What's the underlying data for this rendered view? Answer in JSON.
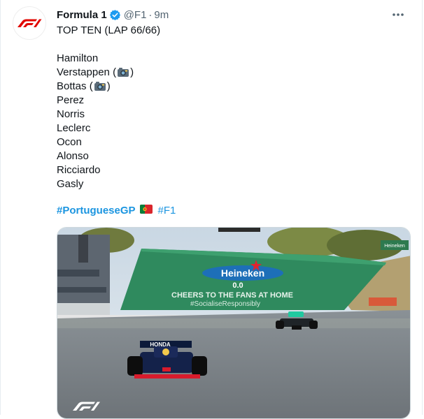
{
  "account": {
    "name": "Formula 1",
    "handle": "@F1",
    "separator": "·",
    "time": "9m"
  },
  "tweet": {
    "headline": "TOP TEN (LAP 66/66)",
    "drivers": [
      {
        "name": "Hamilton",
        "note": ""
      },
      {
        "name": "Verstappen",
        "note": "camera"
      },
      {
        "name": "Bottas",
        "note": "camera"
      },
      {
        "name": "Perez",
        "note": ""
      },
      {
        "name": "Norris",
        "note": ""
      },
      {
        "name": "Leclerc",
        "note": ""
      },
      {
        "name": "Ocon",
        "note": ""
      },
      {
        "name": "Alonso",
        "note": ""
      },
      {
        "name": "Ricciardo",
        "note": ""
      },
      {
        "name": "Gasly",
        "note": ""
      }
    ],
    "hashtag_main": "#PortugueseGP",
    "hashtag_secondary": "#F1"
  },
  "media": {
    "banner_brand": "Heineken",
    "banner_brand_sub": "0.0",
    "banner_text_1": "CHEERS TO THE FANS AT HOME",
    "banner_text_2": "#SocialiseResponsibly",
    "car_sponsor": "HONDA",
    "signage": "Heineken",
    "watermark": "F1"
  },
  "icons": {
    "more": "more-horizontal-icon",
    "verified": "verified-badge-icon",
    "avatar": "f1-logo-icon",
    "camera": "camera-emoji-icon",
    "flag": "portugal-flag-emoji-icon"
  },
  "colors": {
    "f1_red": "#e10600",
    "verified_blue": "#1d9bf0",
    "link_blue": "#1b95e0",
    "secondary_text": "#536471"
  }
}
